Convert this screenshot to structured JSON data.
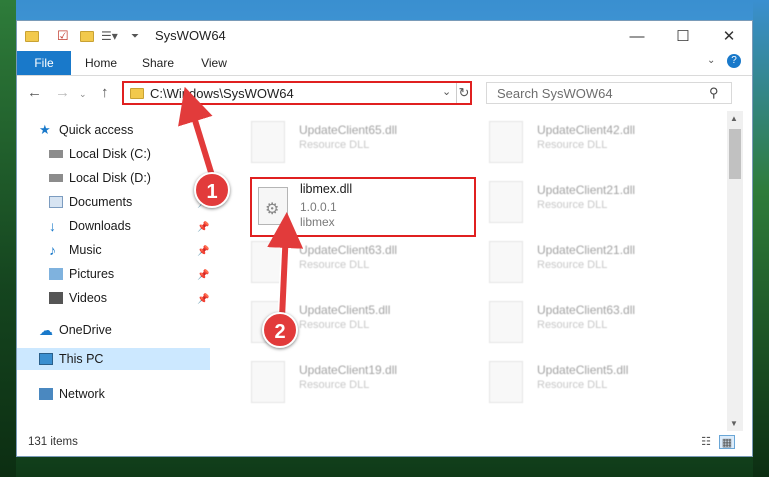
{
  "window": {
    "title": "SysWOW64",
    "minimize": "—",
    "maximize": "☐",
    "close": "✕"
  },
  "ribbon": {
    "tabs": [
      {
        "label": "File"
      },
      {
        "label": "Home"
      },
      {
        "label": "Share"
      },
      {
        "label": "View"
      }
    ]
  },
  "address": {
    "path": "C:\\Windows\\SysWOW64",
    "search_placeholder": "Search SysWOW64"
  },
  "sidebar": {
    "items": [
      {
        "label": "Quick access",
        "icon": "star-icon",
        "pinned": false
      },
      {
        "label": "Local Disk (C:)",
        "icon": "drive-icon",
        "pinned": false
      },
      {
        "label": "Local Disk (D:)",
        "icon": "drive-icon",
        "pinned": false
      },
      {
        "label": "Documents",
        "icon": "documents-icon",
        "pinned": true
      },
      {
        "label": "Downloads",
        "icon": "download-icon",
        "pinned": true
      },
      {
        "label": "Music",
        "icon": "music-icon",
        "pinned": true
      },
      {
        "label": "Pictures",
        "icon": "pictures-icon",
        "pinned": true
      },
      {
        "label": "Videos",
        "icon": "videos-icon",
        "pinned": true
      },
      {
        "label": "OneDrive",
        "icon": "cloud-icon",
        "pinned": false
      },
      {
        "label": "This PC",
        "icon": "computer-icon",
        "pinned": false
      },
      {
        "label": "Network",
        "icon": "network-icon",
        "pinned": false
      }
    ]
  },
  "files": {
    "left": [
      {
        "name": "UpdateClient65.dll",
        "desc": "Resource DLL"
      },
      {
        "name": "UpdateClient63.dll",
        "desc": "Resource DLL"
      },
      {
        "name": "UpdateClient5.dll",
        "desc": "Resource DLL"
      },
      {
        "name": "UpdateClient19.dll",
        "desc": "Resource DLL"
      }
    ],
    "right": [
      {
        "name": "UpdateClient42.dll",
        "desc": "Resource DLL"
      },
      {
        "name": "UpdateClient21.dll",
        "desc": "Resource DLL"
      },
      {
        "name": "UpdateClient21.dll",
        "desc": "Resource DLL"
      },
      {
        "name": "UpdateClient63.dll",
        "desc": "Resource DLL"
      },
      {
        "name": "UpdateClient5.dll",
        "desc": "Resource DLL"
      }
    ],
    "highlighted": {
      "name": "libmex.dll",
      "version": "1.0.0.1",
      "description": "libmex"
    }
  },
  "status": {
    "item_count": "131 items"
  },
  "annotations": {
    "step1": "1",
    "step2": "2",
    "color": "#e02020"
  }
}
